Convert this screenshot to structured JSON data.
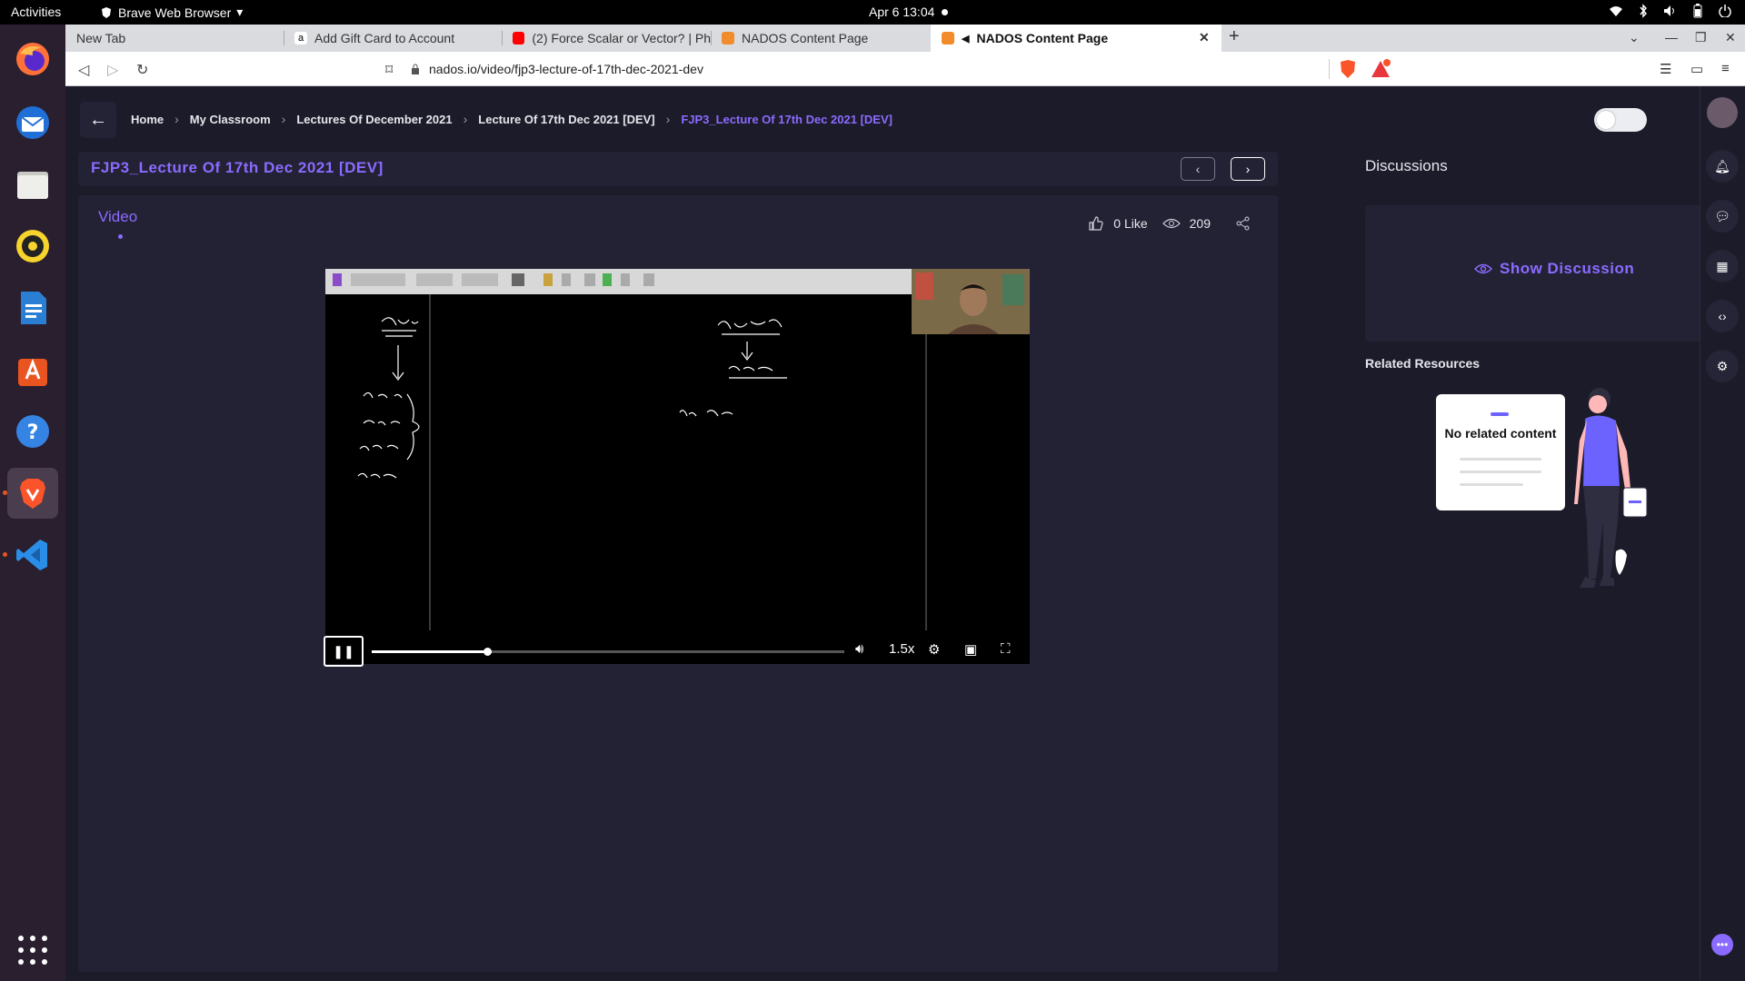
{
  "system": {
    "activities": "Activities",
    "app_name": "Brave Web Browser",
    "clock": "Apr 6  13:04"
  },
  "tabs": [
    {
      "label": "New Tab"
    },
    {
      "label": "Add Gift Card to Account"
    },
    {
      "label": "(2) Force Scalar or Vector? | Ph"
    },
    {
      "label": "NADOS Content Page"
    },
    {
      "label": "NADOS Content Page"
    }
  ],
  "address": {
    "url": "nados.io/video/fjp3-lecture-of-17th-dec-2021-dev"
  },
  "breadcrumb": [
    "Home",
    "My Classroom",
    "Lectures Of December 2021",
    "Lecture Of 17th Dec 2021 [DEV]",
    "FJP3_Lecture Of 17th Dec 2021 [DEV]"
  ],
  "content": {
    "title": "FJP3_Lecture Of 17th Dec 2021 [DEV]",
    "tab_label": "Video",
    "likes": "0 Like",
    "views": "209"
  },
  "player": {
    "speed": "1.5x",
    "progress_fraction": 0.245
  },
  "discussion": {
    "title": "Discussions",
    "show_label": "Show Discussion",
    "related_title": "Related Resources",
    "no_content": "No related content"
  },
  "colors": {
    "accent": "#8b6bff",
    "bg": "#1c1b29",
    "panel": "#232234"
  }
}
